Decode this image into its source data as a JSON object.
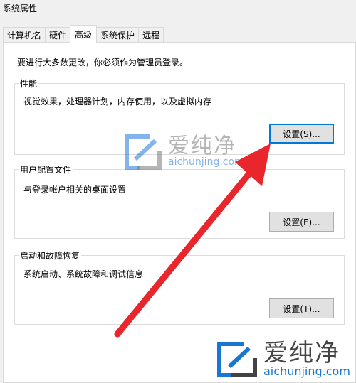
{
  "window": {
    "title": "系统属性"
  },
  "tabs": [
    {
      "label": "计算机名",
      "active": false
    },
    {
      "label": "硬件",
      "active": false
    },
    {
      "label": "高级",
      "active": true
    },
    {
      "label": "系统保护",
      "active": false
    },
    {
      "label": "远程",
      "active": false
    }
  ],
  "advanced": {
    "admin_note": "要进行大多数更改，你必须作为管理员登录。",
    "performance": {
      "label": "性能",
      "description": "视觉效果，处理器计划，内存使用，以及虚拟内存",
      "button": "设置(S)..."
    },
    "user_profiles": {
      "label": "用户配置文件",
      "description": "与登录帐户相关的桌面设置",
      "button": "设置(E)..."
    },
    "startup_recovery": {
      "label": "启动和故障恢复",
      "description": "系统启动、系统故障和调试信息",
      "button": "设置(T)..."
    }
  },
  "watermark": {
    "cn": "爱纯净",
    "en": "aichunjing.com"
  },
  "colors": {
    "arrow": "#e8262b",
    "focus_border": "#0078d7",
    "watermark_blue": "#1976d2"
  }
}
